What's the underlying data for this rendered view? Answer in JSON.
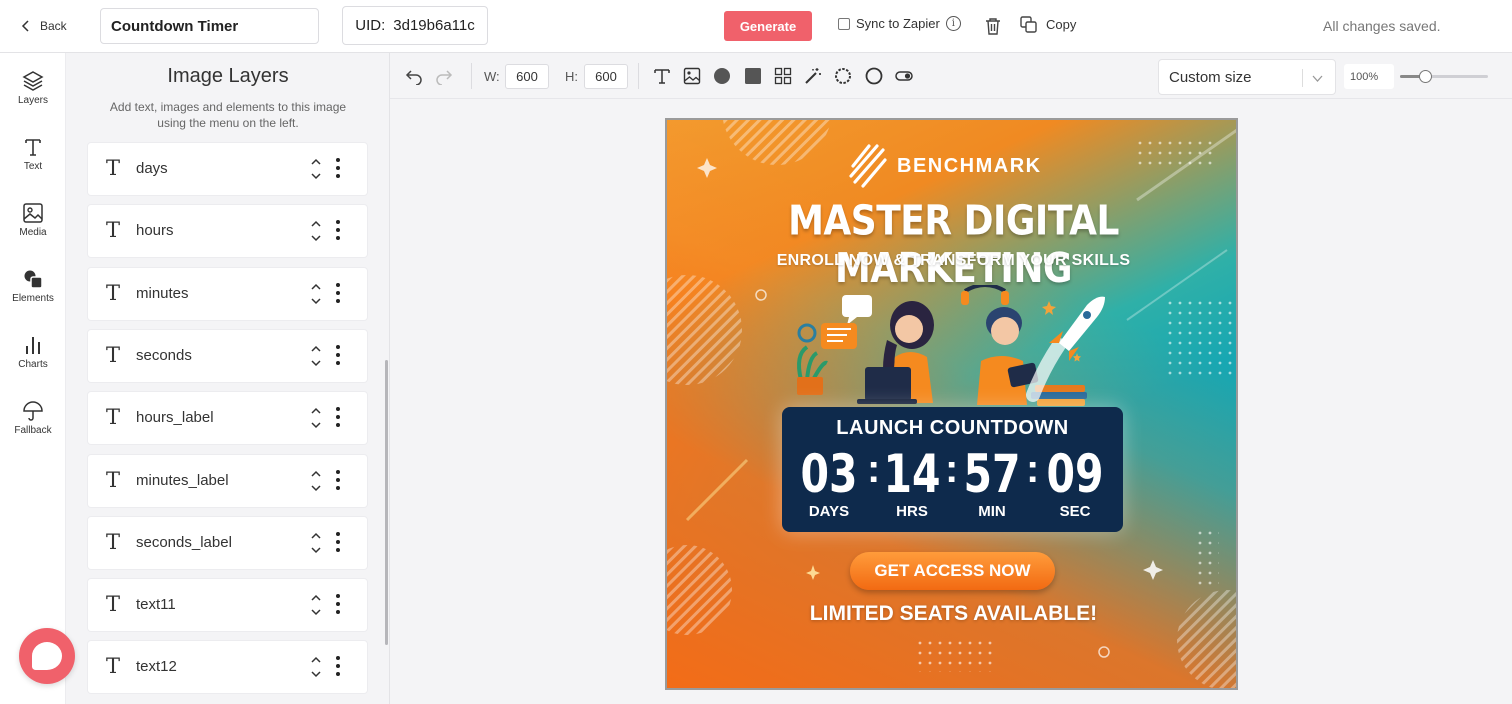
{
  "header": {
    "back_label": "Back",
    "title_value": "Countdown Timer",
    "uid_label": "UID:",
    "uid_value": "3d19b6a11c",
    "generate_label": "Generate",
    "sync_label": "Sync to Zapier",
    "copy_label": "Copy",
    "status_text": "All changes saved.",
    "accent_color": "#f0616b"
  },
  "rail": {
    "items": [
      {
        "label": "Layers",
        "icon": "layers-icon",
        "active": true
      },
      {
        "label": "Text",
        "icon": "text-icon"
      },
      {
        "label": "Media",
        "icon": "image-icon"
      },
      {
        "label": "Elements",
        "icon": "shapes-icon"
      },
      {
        "label": "Charts",
        "icon": "bar-chart-icon"
      },
      {
        "label": "Fallback",
        "icon": "umbrella-icon"
      }
    ]
  },
  "panel": {
    "title": "Image Layers",
    "description": "Add text, images and elements to this image using the menu on the left.",
    "layers": [
      {
        "type_glyph": "T",
        "name": "days"
      },
      {
        "type_glyph": "T",
        "name": "hours"
      },
      {
        "type_glyph": "T",
        "name": "minutes"
      },
      {
        "type_glyph": "T",
        "name": "seconds"
      },
      {
        "type_glyph": "T",
        "name": "hours_label"
      },
      {
        "type_glyph": "T",
        "name": "minutes_label"
      },
      {
        "type_glyph": "T",
        "name": "seconds_label"
      },
      {
        "type_glyph": "T",
        "name": "text11"
      },
      {
        "type_glyph": "T",
        "name": "text12"
      }
    ]
  },
  "toolbar": {
    "width_label": "W:",
    "width_value": "600",
    "height_label": "H:",
    "height_value": "600",
    "size_select_value": "Custom size",
    "zoom_value": "100%",
    "zoom_fraction": 0.28
  },
  "canvas": {
    "brand_name": "BENCHMARK",
    "headline": "MASTER DIGITAL MARKETING",
    "subhead": "ENROLL NOW & TRANSFORM YOUR SKILLS",
    "countdown_title": "LAUNCH COUNTDOWN",
    "countdown": {
      "days": "03",
      "hours": "14",
      "minutes": "57",
      "seconds": "09",
      "days_label": "DAYS",
      "hours_label": "HRS",
      "minutes_label": "MIN",
      "seconds_label": "SEC"
    },
    "cta_label": "GET ACCESS NOW",
    "footer_text": "LIMITED SEATS AVAILABLE!"
  }
}
